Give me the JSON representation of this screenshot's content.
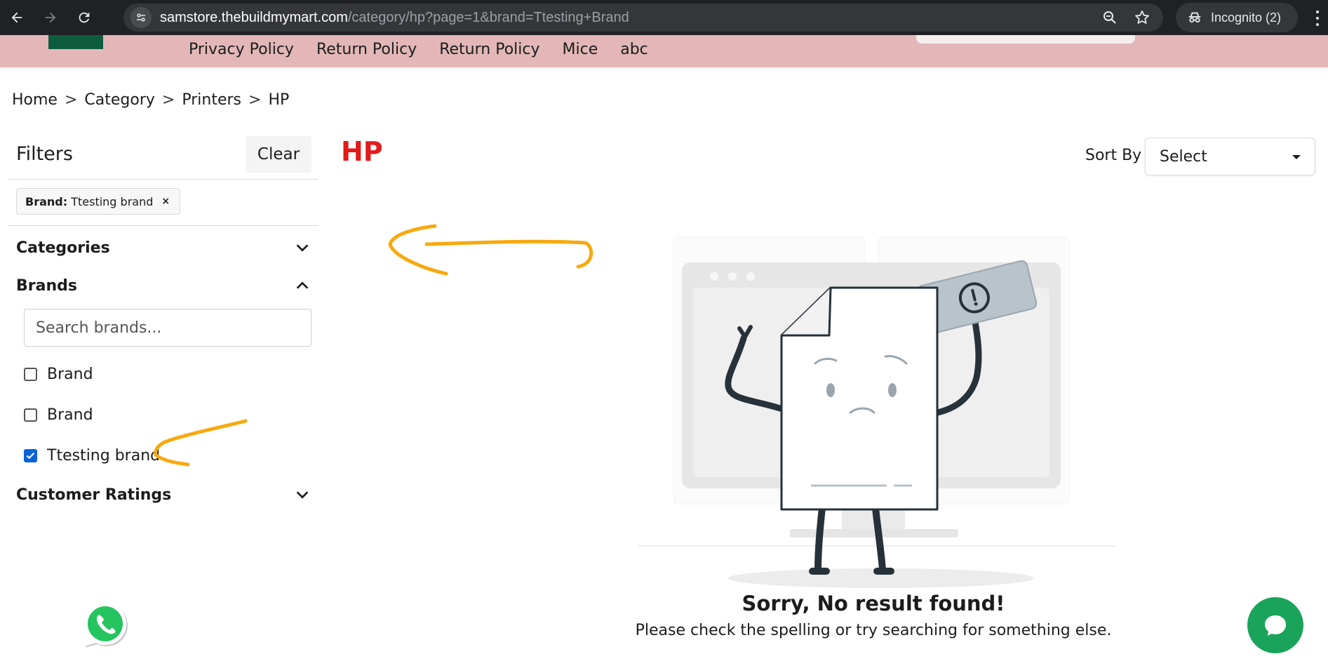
{
  "browser": {
    "url_host": "samstore.thebuildmymart.com",
    "url_path": "/category/hp?page=1&brand=Ttesting+Brand",
    "incognito_label": "Incognito (2)"
  },
  "header": {
    "nav_items": [
      "Privacy Policy",
      "Return Policy",
      "Return Policy",
      "Mice",
      "abc"
    ]
  },
  "breadcrumb": [
    "Home",
    "Category",
    "Printers",
    "HP"
  ],
  "breadcrumb_separator": ">",
  "sidebar": {
    "title": "Filters",
    "clear_label": "Clear",
    "active_filter": {
      "key": "Brand:",
      "value": "Ttesting brand",
      "remove": "×"
    },
    "sections": {
      "categories": "Categories",
      "brands": "Brands",
      "ratings": "Customer Ratings"
    },
    "brand_search_placeholder": "Search brands...",
    "brands": [
      {
        "label": "Brand",
        "checked": false
      },
      {
        "label": "Brand",
        "checked": false
      },
      {
        "label": "Ttesting brand",
        "checked": true
      }
    ]
  },
  "main": {
    "title": "HP",
    "sort_label": "Sort By",
    "sort_value": "Select",
    "empty_title": "Sorry, No result found!",
    "empty_subtitle": "Please check the spelling or try searching for something else."
  },
  "colors": {
    "title_red": "#e21a1a",
    "header_pink": "#e3b7b8",
    "annotation_orange": "#f7a90f",
    "chat_green": "#1aa35a"
  },
  "icons": [
    "back-arrow-icon",
    "forward-arrow-icon",
    "reload-icon",
    "site-info-icon",
    "zoom-icon",
    "star-icon",
    "incognito-icon",
    "more-vert-icon",
    "chevron-down-icon",
    "chevron-up-icon",
    "whatsapp-icon",
    "chat-bubble-icon"
  ]
}
